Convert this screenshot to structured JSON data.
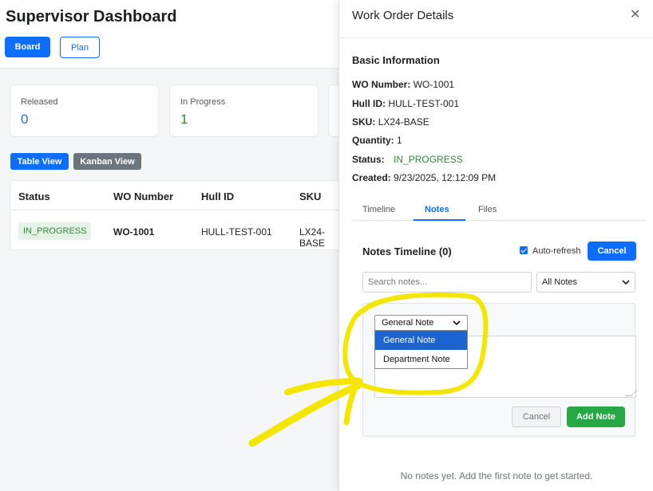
{
  "dashboard": {
    "title": "Supervisor Dashboard",
    "buttons": {
      "board": "Board",
      "plan": "Plan"
    },
    "stats": [
      {
        "label": "Released",
        "value": "0",
        "color": "#2f6fd1"
      },
      {
        "label": "In Progress",
        "value": "1",
        "color": "#2f8a3c"
      }
    ],
    "view_buttons": {
      "table": "Table View",
      "kanban": "Kanban View"
    },
    "table": {
      "headers": [
        "Status",
        "WO Number",
        "Hull ID",
        "SKU"
      ],
      "rows": [
        {
          "status": "IN_PROGRESS",
          "wo_number": "WO-1001",
          "hull_id": "HULL-TEST-001",
          "sku": "LX24-BASE"
        }
      ]
    }
  },
  "panel": {
    "title": "Work Order Details",
    "close_icon": "close-icon",
    "basic_info": {
      "title": "Basic Information",
      "wo_number_label": "WO Number:",
      "wo_number": "WO-1001",
      "hull_id_label": "Hull ID:",
      "hull_id": "HULL-TEST-001",
      "sku_label": "SKU:",
      "sku": "LX24-BASE",
      "quantity_label": "Quantity:",
      "quantity": "1",
      "status_label": "Status:",
      "status": "IN_PROGRESS",
      "created_label": "Created:",
      "created": "9/23/2025, 12:12:09 PM"
    },
    "tabs": [
      "Timeline",
      "Notes",
      "Files"
    ],
    "active_tab": "Notes",
    "notes": {
      "title": "Notes Timeline (0)",
      "auto_refresh_label": "Auto-refresh",
      "auto_refresh_checked": true,
      "cancel_label": "Cancel",
      "search_placeholder": "Search notes...",
      "filter_value": "All Notes",
      "form": {
        "type_value": "General Note",
        "type_options": [
          "General Note",
          "Department Note"
        ],
        "cancel_label": "Cancel",
        "add_label": "Add Note"
      },
      "empty_message": "No notes yet. Add the first note to get started."
    }
  },
  "colors": {
    "primary": "#0d6efd",
    "success": "#28a745",
    "status_green": "#2f8a3c",
    "highlighter": "#f5e600"
  }
}
